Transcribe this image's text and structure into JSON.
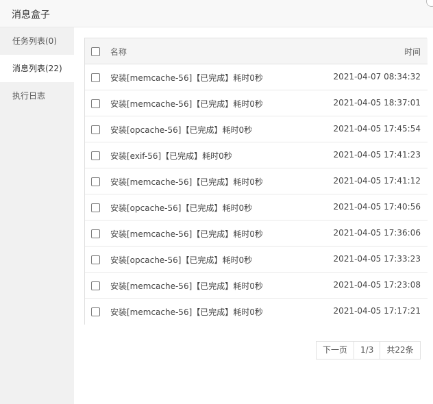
{
  "window": {
    "title": "消息盒子"
  },
  "sidebar": {
    "items": [
      {
        "label": "任务列表(0)"
      },
      {
        "label": "消息列表(22)"
      },
      {
        "label": "执行日志"
      }
    ]
  },
  "table": {
    "headers": {
      "name": "名称",
      "time": "时间"
    },
    "rows": [
      {
        "name": "安装[memcache-56]【已完成】耗时0秒",
        "time": "2021-04-07 08:34:32"
      },
      {
        "name": "安装[memcache-56]【已完成】耗时0秒",
        "time": "2021-04-05 18:37:01"
      },
      {
        "name": "安装[opcache-56]【已完成】耗时0秒",
        "time": "2021-04-05 17:45:54"
      },
      {
        "name": "安装[exif-56]【已完成】耗时0秒",
        "time": "2021-04-05 17:41:23"
      },
      {
        "name": "安装[memcache-56]【已完成】耗时0秒",
        "time": "2021-04-05 17:41:12"
      },
      {
        "name": "安装[opcache-56]【已完成】耗时0秒",
        "time": "2021-04-05 17:40:56"
      },
      {
        "name": "安装[memcache-56]【已完成】耗时0秒",
        "time": "2021-04-05 17:36:06"
      },
      {
        "name": "安装[opcache-56]【已完成】耗时0秒",
        "time": "2021-04-05 17:33:23"
      },
      {
        "name": "安装[memcache-56]【已完成】耗时0秒",
        "time": "2021-04-05 17:23:08"
      },
      {
        "name": "安装[memcache-56]【已完成】耗时0秒",
        "time": "2021-04-05 17:17:21"
      }
    ]
  },
  "pagination": {
    "next_label": "下一页",
    "page": "1/3",
    "total": "共22条"
  }
}
